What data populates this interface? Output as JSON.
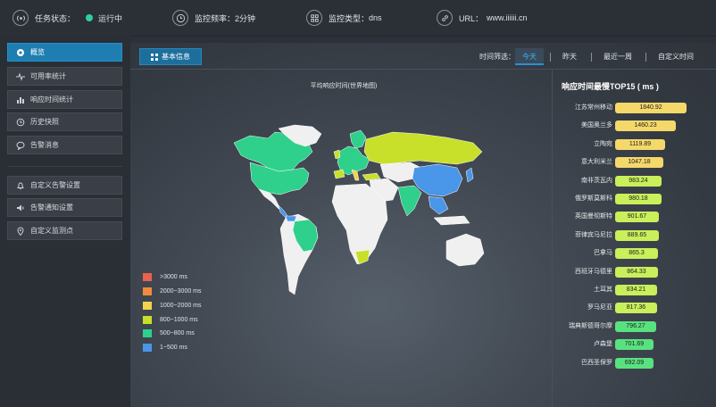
{
  "topbar": {
    "status_label": "任务状态：",
    "status_value": "运行中",
    "freq_label": "监控频率：",
    "freq_value": "2分钟",
    "type_label": "监控类型：",
    "type_value": "dns",
    "url_label": "URL：",
    "url_value": "www.iiiiii.cn"
  },
  "sidebar": {
    "items": [
      {
        "label": "概览",
        "icon": "dashboard-icon"
      },
      {
        "label": "可用率统计",
        "icon": "pulse-icon"
      },
      {
        "label": "响应时间统计",
        "icon": "bar-chart-icon"
      },
      {
        "label": "历史快照",
        "icon": "history-icon"
      },
      {
        "label": "告警消息",
        "icon": "message-icon"
      }
    ],
    "items2": [
      {
        "label": "自定义告警设置",
        "icon": "bell-icon"
      },
      {
        "label": "告警通知设置",
        "icon": "speaker-icon"
      },
      {
        "label": "自定义监测点",
        "icon": "location-pin-icon"
      }
    ]
  },
  "main": {
    "basic_info": "基本信息",
    "time_filter_label": "时间筛选：",
    "time_filters": [
      "今天",
      "昨天",
      "最近一周",
      "自定义时间"
    ],
    "map_title": "平均响应时间(世界地图)"
  },
  "legend": [
    {
      "label": ">3000 ms",
      "color": "#e8624f"
    },
    {
      "label": "2000~3000 ms",
      "color": "#f28a3c"
    },
    {
      "label": "1000~2000 ms",
      "color": "#f5d24d"
    },
    {
      "label": "800~1000 ms",
      "color": "#c8e02a"
    },
    {
      "label": "500~800 ms",
      "color": "#2ed08c"
    },
    {
      "label": "1~500 ms",
      "color": "#4a96e8"
    }
  ],
  "top15": {
    "title": "响应时间最慢TOP15 ( ms )",
    "rows": [
      {
        "city": "江苏常州移动",
        "value": "1840.92",
        "color": "#f5d86a"
      },
      {
        "city": "美国奥兰多",
        "value": "1460.23",
        "color": "#f5d86a"
      },
      {
        "city": "立陶宛",
        "value": "1119.89",
        "color": "#f5d86a"
      },
      {
        "city": "意大利米兰",
        "value": "1047.18",
        "color": "#f5d86a"
      },
      {
        "city": "南非茨瓦内",
        "value": "983.24",
        "color": "#c9ef5a"
      },
      {
        "city": "俄罗斯莫斯科",
        "value": "980.18",
        "color": "#c9ef5a"
      },
      {
        "city": "英国曼彻斯特",
        "value": "901.67",
        "color": "#c9ef5a"
      },
      {
        "city": "菲律宾马尼拉",
        "value": "889.65",
        "color": "#c9ef5a"
      },
      {
        "city": "巴拿马",
        "value": "865.3",
        "color": "#c9ef5a"
      },
      {
        "city": "西班牙马德里",
        "value": "864.33",
        "color": "#c9ef5a"
      },
      {
        "city": "土耳其",
        "value": "834.21",
        "color": "#c9ef5a"
      },
      {
        "city": "罗马尼亚",
        "value": "817.36",
        "color": "#c9ef5a"
      },
      {
        "city": "瑞典斯德哥尔摩",
        "value": "796.27",
        "color": "#58e27f"
      },
      {
        "city": "卢森堡",
        "value": "701.69",
        "color": "#58e27f"
      },
      {
        "city": "巴西圣保罗",
        "value": "692.09",
        "color": "#58e27f"
      }
    ]
  }
}
